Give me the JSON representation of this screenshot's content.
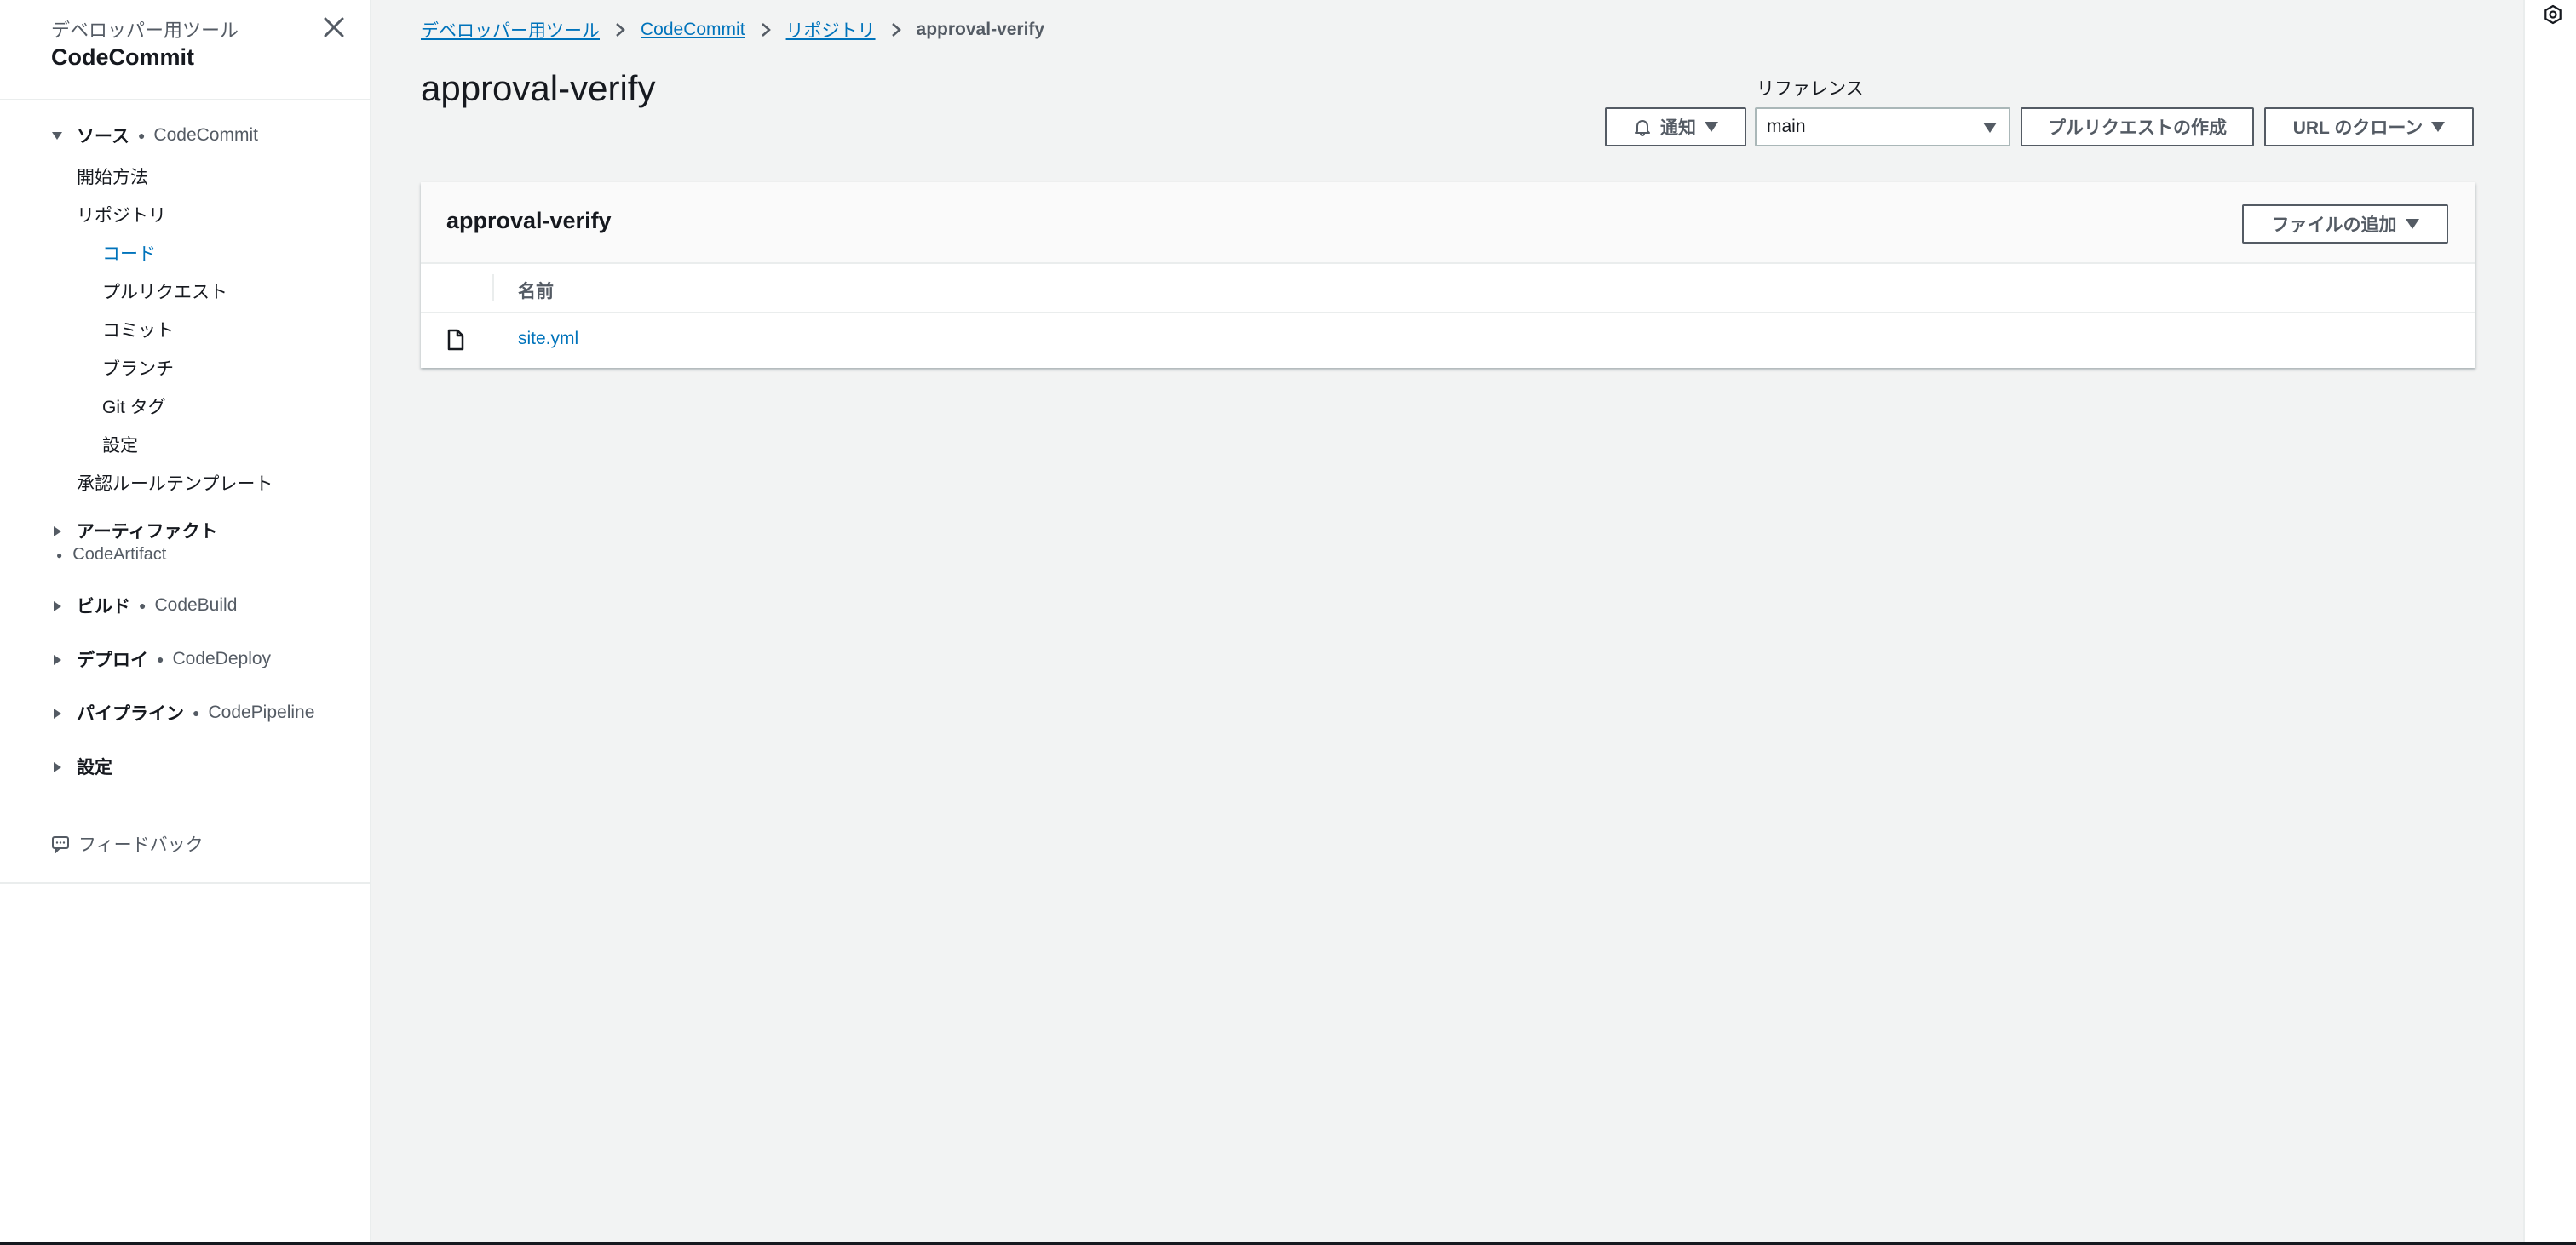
{
  "sidebar": {
    "subtitle": "デベロッパー用ツール",
    "title": "CodeCommit",
    "sections": [
      {
        "label": "ソース",
        "service": "CodeCommit"
      },
      {
        "label": "アーティファクト",
        "service": "CodeArtifact"
      },
      {
        "label": "ビルド",
        "service": "CodeBuild"
      },
      {
        "label": "デプロイ",
        "service": "CodeDeploy"
      },
      {
        "label": "パイプライン",
        "service": "CodePipeline"
      },
      {
        "label": "設定"
      }
    ],
    "source_items": [
      "開始方法",
      "リポジトリ",
      "コード",
      "プルリクエスト",
      "コミット",
      "ブランチ",
      "Git タグ",
      "設定",
      "承認ルールテンプレート"
    ],
    "active_item": "コード",
    "feedback": "フィードバック"
  },
  "breadcrumb": [
    "デベロッパー用ツール",
    "CodeCommit",
    "リポジトリ",
    "approval-verify"
  ],
  "page": {
    "title": "approval-verify",
    "reference_label": "リファレンス",
    "reference_value": "main",
    "notify_button": "通知",
    "create_pr_button": "プルリクエストの作成",
    "clone_url_button": "URL のクローン"
  },
  "panel": {
    "title": "approval-verify",
    "add_file_button": "ファイルの追加",
    "column_name": "名前",
    "files": [
      {
        "name": "site.yml",
        "icon": "file-icon"
      }
    ]
  },
  "colors": {
    "link": "#0073bb",
    "background": "#f2f3f3",
    "text": "#16191f",
    "secondary": "#545b64"
  }
}
